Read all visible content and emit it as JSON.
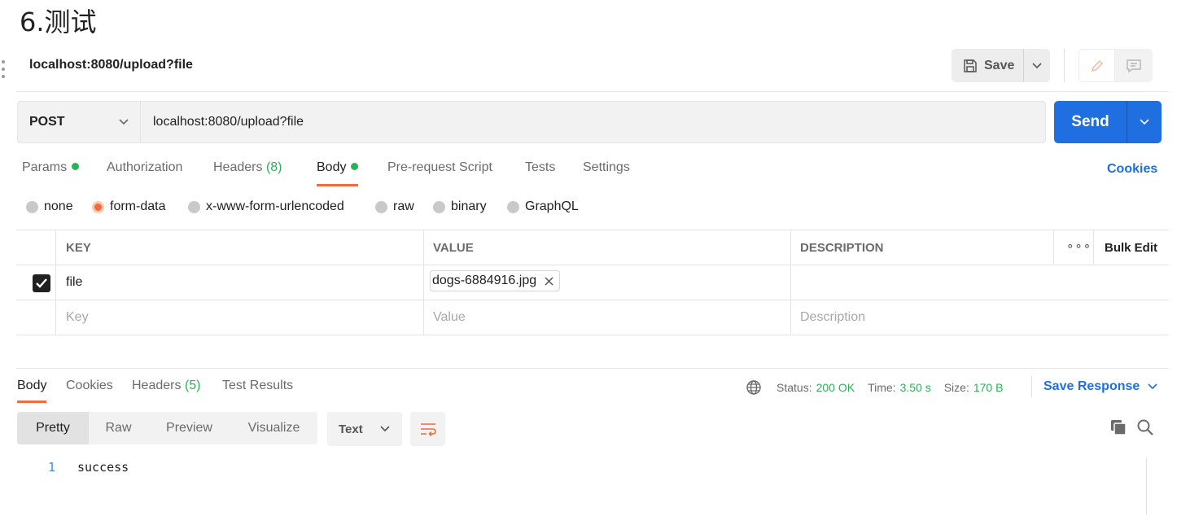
{
  "page": {
    "heading": "6.测试"
  },
  "request": {
    "title": "localhost:8080/upload?file",
    "save_label": "Save",
    "method": "POST",
    "url": "localhost:8080/upload?file",
    "send_label": "Send"
  },
  "tabs": {
    "params": "Params",
    "authorization": "Authorization",
    "headers": "Headers",
    "headers_count": "(8)",
    "body": "Body",
    "prerequest": "Pre-request Script",
    "tests": "Tests",
    "settings": "Settings",
    "cookies": "Cookies",
    "active": "Body"
  },
  "body_types": {
    "none": "none",
    "form_data": "form-data",
    "urlencoded": "x-www-form-urlencoded",
    "raw": "raw",
    "binary": "binary",
    "graphql": "GraphQL",
    "selected": "form-data"
  },
  "form_table": {
    "headers": {
      "key": "KEY",
      "value": "VALUE",
      "description": "DESCRIPTION",
      "bulk_edit": "Bulk Edit"
    },
    "rows": [
      {
        "key": "file",
        "value": "dogs-6884916.jpg",
        "description": "",
        "checked": true
      }
    ],
    "placeholders": {
      "key": "Key",
      "value": "Value",
      "description": "Description"
    }
  },
  "response": {
    "tabs": {
      "body": "Body",
      "cookies": "Cookies",
      "headers": "Headers",
      "headers_count": "(5)",
      "test_results": "Test Results"
    },
    "status_label": "Status:",
    "status_value": "200 OK",
    "time_label": "Time:",
    "time_value": "3.50 s",
    "size_label": "Size:",
    "size_value": "170 B",
    "save_response": "Save Response",
    "views": {
      "pretty": "Pretty",
      "raw": "Raw",
      "preview": "Preview",
      "visualize": "Visualize"
    },
    "format": "Text",
    "lines": [
      {
        "number": "1",
        "text": "success"
      }
    ]
  },
  "colors": {
    "accent_orange": "#f26b3a",
    "send_blue": "#1f6fe0",
    "success_green": "#2ab256"
  },
  "icons": [
    "save-icon",
    "chevron-down-icon",
    "pencil-icon",
    "comment-icon",
    "globe-icon",
    "wrap-lines-icon",
    "copy-icon",
    "search-icon",
    "check-icon",
    "close-icon",
    "more-icon"
  ]
}
